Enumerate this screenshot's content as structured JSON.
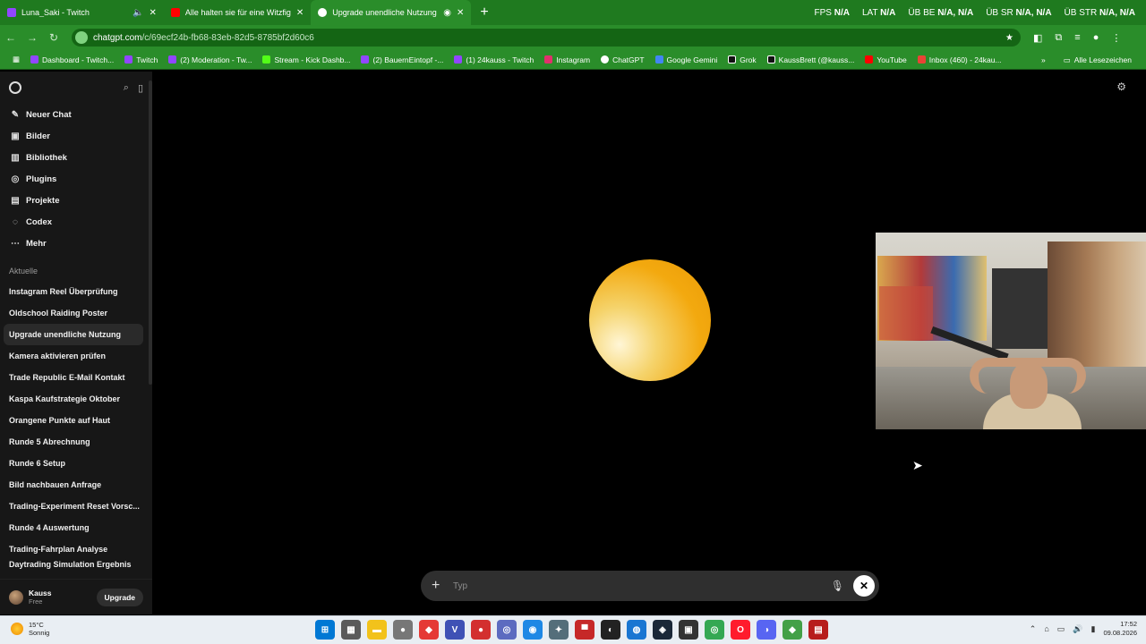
{
  "browser": {
    "tabs": [
      {
        "title": "Luna_Saki - Twitch",
        "color": "#9146ff"
      },
      {
        "title": "Alle halten sie für eine Witzfigur",
        "color": "#ff0000"
      },
      {
        "title": "Upgrade unendliche Nutzung",
        "color": "#ffffff"
      }
    ],
    "new_tab": "+",
    "stats": [
      {
        "label": "FPS",
        "value": "N/A"
      },
      {
        "label": "LAT",
        "value": "N/A"
      },
      {
        "label": "ÜB BE",
        "value": "N/A, N/A"
      },
      {
        "label": "ÜB SR",
        "value": "N/A, N/A"
      },
      {
        "label": "ÜB STR",
        "value": "N/A, N/A"
      }
    ],
    "url_host": "chatgpt.com",
    "url_path": "/c/69ecf24b-fb68-83eb-82d5-8785bf2d60c6",
    "bookmarks": [
      {
        "label": "Dashboard - Twitch...",
        "color": "#9146ff"
      },
      {
        "label": "Twitch",
        "color": "#9146ff"
      },
      {
        "label": "(2) Moderation - Tw...",
        "color": "#9146ff"
      },
      {
        "label": "Stream - Kick Dashb...",
        "color": "#53fc18"
      },
      {
        "label": "(2) BauernEintopf -...",
        "color": "#9146ff"
      },
      {
        "label": "(1) 24kauss - Twitch",
        "color": "#9146ff"
      },
      {
        "label": "Instagram",
        "color": "#e1306c"
      },
      {
        "label": "ChatGPT",
        "color": "#ffffff"
      },
      {
        "label": "Google Gemini",
        "color": "#4285f4"
      },
      {
        "label": "Grok",
        "color": "#111111"
      },
      {
        "label": "KaussBrett (@kauss...",
        "color": "#111111"
      },
      {
        "label": "YouTube",
        "color": "#ff0000"
      },
      {
        "label": "Inbox (460) - 24kau...",
        "color": "#ea4335"
      }
    ],
    "more_bookmarks": "»",
    "all_bookmarks": "Alle Lesezeichen"
  },
  "sidebar": {
    "menu": [
      {
        "label": "Neuer Chat",
        "icon": "✎"
      },
      {
        "label": "Bilder",
        "icon": "▣"
      },
      {
        "label": "Bibliothek",
        "icon": "▥"
      },
      {
        "label": "Plugins",
        "icon": "◎"
      },
      {
        "label": "Projekte",
        "icon": "▤"
      },
      {
        "label": "Codex",
        "icon": "◌"
      },
      {
        "label": "Mehr",
        "icon": "⋯"
      }
    ],
    "section_label": "Aktuelle",
    "chats": [
      "Instagram Reel Überprüfung",
      "Oldschool Raiding Poster",
      "Upgrade unendliche Nutzung",
      "Kamera aktivieren prüfen",
      "Trade Republic E-Mail Kontakt",
      "Kaspa Kaufstrategie Oktober",
      "Orangene Punkte auf Haut",
      "Runde 5 Abrechnung",
      "Runde 6 Setup",
      "Bild nachbauen Anfrage",
      "Trading-Experiment Reset Vorsc...",
      "Runde 4 Auswertung",
      "Trading-Fahrplan Analyse",
      "Daytrading Simulation Ergebnis"
    ],
    "active_chat_index": 2,
    "user": {
      "name": "Kauss",
      "plan": "Free"
    },
    "upgrade_label": "Upgrade"
  },
  "composer": {
    "placeholder": "Typ",
    "plus": "+",
    "stop": "✕"
  },
  "taskbar": {
    "weather_temp": "15°C",
    "weather_desc": "Sonnig",
    "time": "17:52",
    "date": "09.08.2026",
    "apps": [
      {
        "name": "start",
        "color": "#0078d4",
        "glyph": "⊞"
      },
      {
        "name": "calculator",
        "color": "#5a5a5a",
        "glyph": "▦"
      },
      {
        "name": "explorer",
        "color": "#f2c21b",
        "glyph": "▬"
      },
      {
        "name": "mouse",
        "color": "#777777",
        "glyph": "●"
      },
      {
        "name": "app-red",
        "color": "#e53935",
        "glyph": "◆"
      },
      {
        "name": "app-v",
        "color": "#3f51b5",
        "glyph": "V"
      },
      {
        "name": "app-rec",
        "color": "#d32f2f",
        "glyph": "●"
      },
      {
        "name": "app-circle",
        "color": "#5c6bc0",
        "glyph": "◎"
      },
      {
        "name": "app-blue",
        "color": "#1e88e5",
        "glyph": "◉"
      },
      {
        "name": "app-gear",
        "color": "#546e7a",
        "glyph": "✦"
      },
      {
        "name": "app-stream",
        "color": "#c62828",
        "glyph": "▀"
      },
      {
        "name": "obs",
        "color": "#222222",
        "glyph": "◐"
      },
      {
        "name": "app-edge",
        "color": "#1976d2",
        "glyph": "◍"
      },
      {
        "name": "steam",
        "color": "#1b2838",
        "glyph": "◈"
      },
      {
        "name": "app-dark",
        "color": "#333333",
        "glyph": "▣"
      },
      {
        "name": "chrome",
        "color": "#34a853",
        "glyph": "◎"
      },
      {
        "name": "opera",
        "color": "#ff1b2d",
        "glyph": "O"
      },
      {
        "name": "discord",
        "color": "#5865f2",
        "glyph": "◑"
      },
      {
        "name": "app-multi",
        "color": "#43a047",
        "glyph": "◆"
      },
      {
        "name": "app-media",
        "color": "#b71c1c",
        "glyph": "▤"
      }
    ]
  }
}
